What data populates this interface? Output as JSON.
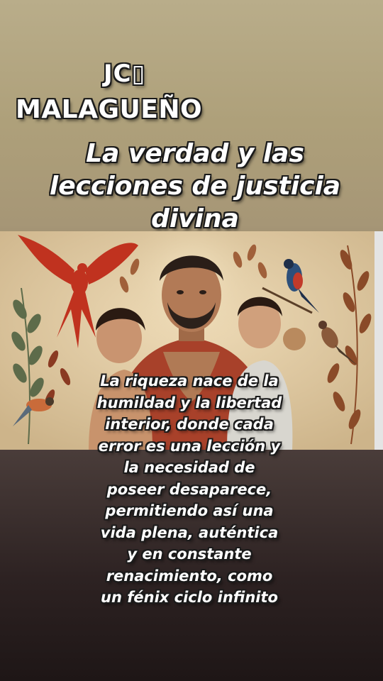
{
  "header": {
    "author_line_1": "JC▯",
    "author_line_2": "MALAGUEÑO"
  },
  "title": {
    "line_1": "La verdad y las",
    "line_2": "lecciones de justicia",
    "line_3": "divina"
  },
  "quote": {
    "lines": [
      "La riqueza nace de la",
      "humildad y la libertad",
      "interior, donde cada",
      "error es una lección y",
      "la necesidad de",
      "poseer desaparece,",
      "permitiendo así una",
      "vida plena, auténtica",
      "y en constante",
      "renacimiento, como",
      "un fénix ciclo infinito"
    ]
  },
  "painting": {
    "subject": "mural of a bearded man holding two children with red phoenix, birds and laurel leaves",
    "colors": {
      "wall": "#e3cfa8",
      "robe": "#a8412a",
      "phoenix": "#c0321f",
      "leaf": "#7a5a3a"
    }
  }
}
